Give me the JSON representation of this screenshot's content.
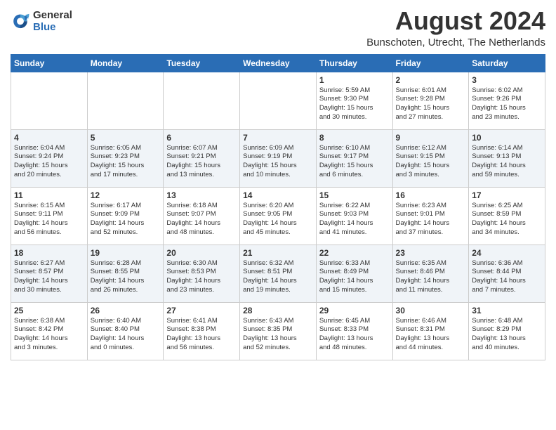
{
  "header": {
    "logo_general": "General",
    "logo_blue": "Blue",
    "month_title": "August 2024",
    "location": "Bunschoten, Utrecht, The Netherlands"
  },
  "days_of_week": [
    "Sunday",
    "Monday",
    "Tuesday",
    "Wednesday",
    "Thursday",
    "Friday",
    "Saturday"
  ],
  "weeks": [
    [
      {
        "day": "",
        "info": ""
      },
      {
        "day": "",
        "info": ""
      },
      {
        "day": "",
        "info": ""
      },
      {
        "day": "",
        "info": ""
      },
      {
        "day": "1",
        "info": "Sunrise: 5:59 AM\nSunset: 9:30 PM\nDaylight: 15 hours\nand 30 minutes."
      },
      {
        "day": "2",
        "info": "Sunrise: 6:01 AM\nSunset: 9:28 PM\nDaylight: 15 hours\nand 27 minutes."
      },
      {
        "day": "3",
        "info": "Sunrise: 6:02 AM\nSunset: 9:26 PM\nDaylight: 15 hours\nand 23 minutes."
      }
    ],
    [
      {
        "day": "4",
        "info": "Sunrise: 6:04 AM\nSunset: 9:24 PM\nDaylight: 15 hours\nand 20 minutes."
      },
      {
        "day": "5",
        "info": "Sunrise: 6:05 AM\nSunset: 9:23 PM\nDaylight: 15 hours\nand 17 minutes."
      },
      {
        "day": "6",
        "info": "Sunrise: 6:07 AM\nSunset: 9:21 PM\nDaylight: 15 hours\nand 13 minutes."
      },
      {
        "day": "7",
        "info": "Sunrise: 6:09 AM\nSunset: 9:19 PM\nDaylight: 15 hours\nand 10 minutes."
      },
      {
        "day": "8",
        "info": "Sunrise: 6:10 AM\nSunset: 9:17 PM\nDaylight: 15 hours\nand 6 minutes."
      },
      {
        "day": "9",
        "info": "Sunrise: 6:12 AM\nSunset: 9:15 PM\nDaylight: 15 hours\nand 3 minutes."
      },
      {
        "day": "10",
        "info": "Sunrise: 6:14 AM\nSunset: 9:13 PM\nDaylight: 14 hours\nand 59 minutes."
      }
    ],
    [
      {
        "day": "11",
        "info": "Sunrise: 6:15 AM\nSunset: 9:11 PM\nDaylight: 14 hours\nand 56 minutes."
      },
      {
        "day": "12",
        "info": "Sunrise: 6:17 AM\nSunset: 9:09 PM\nDaylight: 14 hours\nand 52 minutes."
      },
      {
        "day": "13",
        "info": "Sunrise: 6:18 AM\nSunset: 9:07 PM\nDaylight: 14 hours\nand 48 minutes."
      },
      {
        "day": "14",
        "info": "Sunrise: 6:20 AM\nSunset: 9:05 PM\nDaylight: 14 hours\nand 45 minutes."
      },
      {
        "day": "15",
        "info": "Sunrise: 6:22 AM\nSunset: 9:03 PM\nDaylight: 14 hours\nand 41 minutes."
      },
      {
        "day": "16",
        "info": "Sunrise: 6:23 AM\nSunset: 9:01 PM\nDaylight: 14 hours\nand 37 minutes."
      },
      {
        "day": "17",
        "info": "Sunrise: 6:25 AM\nSunset: 8:59 PM\nDaylight: 14 hours\nand 34 minutes."
      }
    ],
    [
      {
        "day": "18",
        "info": "Sunrise: 6:27 AM\nSunset: 8:57 PM\nDaylight: 14 hours\nand 30 minutes."
      },
      {
        "day": "19",
        "info": "Sunrise: 6:28 AM\nSunset: 8:55 PM\nDaylight: 14 hours\nand 26 minutes."
      },
      {
        "day": "20",
        "info": "Sunrise: 6:30 AM\nSunset: 8:53 PM\nDaylight: 14 hours\nand 23 minutes."
      },
      {
        "day": "21",
        "info": "Sunrise: 6:32 AM\nSunset: 8:51 PM\nDaylight: 14 hours\nand 19 minutes."
      },
      {
        "day": "22",
        "info": "Sunrise: 6:33 AM\nSunset: 8:49 PM\nDaylight: 14 hours\nand 15 minutes."
      },
      {
        "day": "23",
        "info": "Sunrise: 6:35 AM\nSunset: 8:46 PM\nDaylight: 14 hours\nand 11 minutes."
      },
      {
        "day": "24",
        "info": "Sunrise: 6:36 AM\nSunset: 8:44 PM\nDaylight: 14 hours\nand 7 minutes."
      }
    ],
    [
      {
        "day": "25",
        "info": "Sunrise: 6:38 AM\nSunset: 8:42 PM\nDaylight: 14 hours\nand 3 minutes."
      },
      {
        "day": "26",
        "info": "Sunrise: 6:40 AM\nSunset: 8:40 PM\nDaylight: 14 hours\nand 0 minutes."
      },
      {
        "day": "27",
        "info": "Sunrise: 6:41 AM\nSunset: 8:38 PM\nDaylight: 13 hours\nand 56 minutes."
      },
      {
        "day": "28",
        "info": "Sunrise: 6:43 AM\nSunset: 8:35 PM\nDaylight: 13 hours\nand 52 minutes."
      },
      {
        "day": "29",
        "info": "Sunrise: 6:45 AM\nSunset: 8:33 PM\nDaylight: 13 hours\nand 48 minutes."
      },
      {
        "day": "30",
        "info": "Sunrise: 6:46 AM\nSunset: 8:31 PM\nDaylight: 13 hours\nand 44 minutes."
      },
      {
        "day": "31",
        "info": "Sunrise: 6:48 AM\nSunset: 8:29 PM\nDaylight: 13 hours\nand 40 minutes."
      }
    ]
  ]
}
